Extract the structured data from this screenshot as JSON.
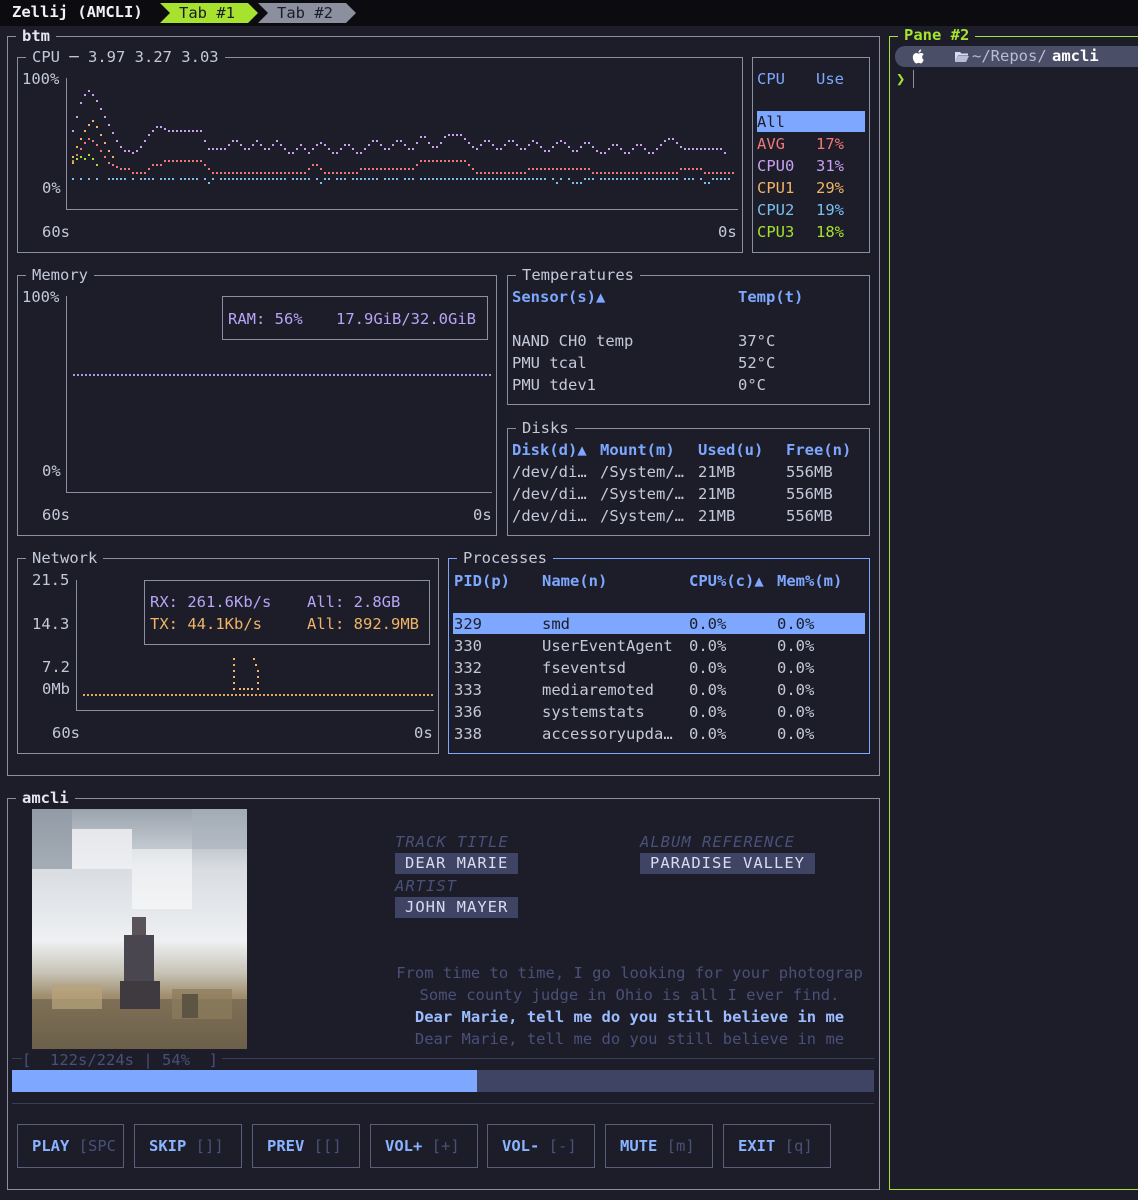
{
  "tabbar": {
    "session": "Zellij (AMCLI)",
    "tabs": [
      {
        "label": "Tab #1",
        "active": true
      },
      {
        "label": "Tab #2",
        "active": false
      }
    ]
  },
  "btm": {
    "title": "btm",
    "cpu": {
      "title": "CPU ─ 3.97 3.27 3.03",
      "y_top": "100%",
      "y_bottom": "0%",
      "x_left": "60s",
      "x_right": "0s",
      "legend_header": {
        "cpu": "CPU",
        "use": "Use"
      },
      "legend": [
        {
          "name": "All",
          "use": "",
          "color": "#1c1d29",
          "selected": true
        },
        {
          "name": "AVG",
          "use": "17%",
          "color": "#f07878"
        },
        {
          "name": "CPU0",
          "use": "31%",
          "color": "#c9a0f0"
        },
        {
          "name": "CPU1",
          "use": "29%",
          "color": "#f0b464"
        },
        {
          "name": "CPU2",
          "use": "19%",
          "color": "#78c0f0"
        },
        {
          "name": "CPU3",
          "use": "18%",
          "color": "#a6e22e"
        }
      ]
    },
    "memory": {
      "title": "Memory",
      "y_top": "100%",
      "y_bottom": "0%",
      "x_left": "60s",
      "x_right": "0s",
      "ram_label": "RAM: 56%",
      "ram_value": "17.9GiB/32.0GiB",
      "ram_percent": 56
    },
    "temperatures": {
      "title": "Temperatures",
      "headers": [
        "Sensor(s)▲",
        "Temp(t)"
      ],
      "rows": [
        [
          "NAND CH0 temp",
          "37°C"
        ],
        [
          "PMU tcal",
          "52°C"
        ],
        [
          "PMU tdev1",
          "0°C"
        ]
      ]
    },
    "disks": {
      "title": "Disks",
      "headers": [
        "Disk(d)▲",
        "Mount(m)",
        "Used(u)",
        "Free(n)"
      ],
      "rows": [
        [
          "/dev/di…",
          "/System/…",
          "21MB",
          "556MB"
        ],
        [
          "/dev/di…",
          "/System/…",
          "21MB",
          "556MB"
        ],
        [
          "/dev/di…",
          "/System/…",
          "21MB",
          "556MB"
        ]
      ]
    },
    "network": {
      "title": "Network",
      "y_ticks": [
        "21.5",
        "14.3",
        "7.2",
        "0Mb"
      ],
      "x_left": "60s",
      "x_right": "0s",
      "rx_label": "RX: 261.6Kb/s",
      "rx_all": "All: 2.8GB",
      "tx_label": "TX: 44.1Kb/s",
      "tx_all": "All: 892.9MB"
    },
    "processes": {
      "title": "Processes",
      "headers": [
        "PID(p)",
        "Name(n)",
        "CPU%(c)▲",
        "Mem%(m)"
      ],
      "rows": [
        [
          "329",
          "smd",
          "0.0%",
          "0.0%"
        ],
        [
          "330",
          "UserEventAgent",
          "0.0%",
          "0.0%"
        ],
        [
          "332",
          "fseventsd",
          "0.0%",
          "0.0%"
        ],
        [
          "333",
          "mediaremoted",
          "0.0%",
          "0.0%"
        ],
        [
          "336",
          "systemstats",
          "0.0%",
          "0.0%"
        ],
        [
          "338",
          "accessoryupda…",
          "0.0%",
          "0.0%"
        ]
      ]
    }
  },
  "amcli": {
    "title": "amcli",
    "track_title_label": "TRACK TITLE",
    "track_title": "DEAR MARIE",
    "artist_label": "ARTIST",
    "artist": "JOHN MAYER",
    "album_label": "ALBUM REFERENCE",
    "album": "PARADISE VALLEY",
    "lyrics": [
      {
        "text": "From time to time, I go looking for your photograp",
        "current": false
      },
      {
        "text": "Some county judge in Ohio is all I ever find.",
        "current": false
      },
      {
        "text": "Dear Marie, tell me do you still believe in me",
        "current": true
      },
      {
        "text": "Dear Marie, tell me do you still believe in me",
        "current": false
      }
    ],
    "progress_text": "[  122s/224s | 54%  ]",
    "progress": 0.54,
    "buttons": [
      {
        "label": "PLAY",
        "key": "[SPC"
      },
      {
        "label": "SKIP",
        "key": "[]]"
      },
      {
        "label": "PREV",
        "key": "[[]"
      },
      {
        "label": "VOL+",
        "key": "[+]"
      },
      {
        "label": "VOL-",
        "key": "[-]"
      },
      {
        "label": "MUTE",
        "key": "[m]"
      },
      {
        "label": "EXIT",
        "key": "[q]"
      }
    ]
  },
  "pane2": {
    "title": "Pane #2",
    "path_prefix": "~/Repos/",
    "path_dir": "amcli",
    "prompt": "❯"
  },
  "colors": {
    "accent_green": "#a6e22e",
    "accent_blue": "#7ea8ff",
    "progress_fill": "#7ea8ff",
    "progress_track": "#3f4465"
  }
}
